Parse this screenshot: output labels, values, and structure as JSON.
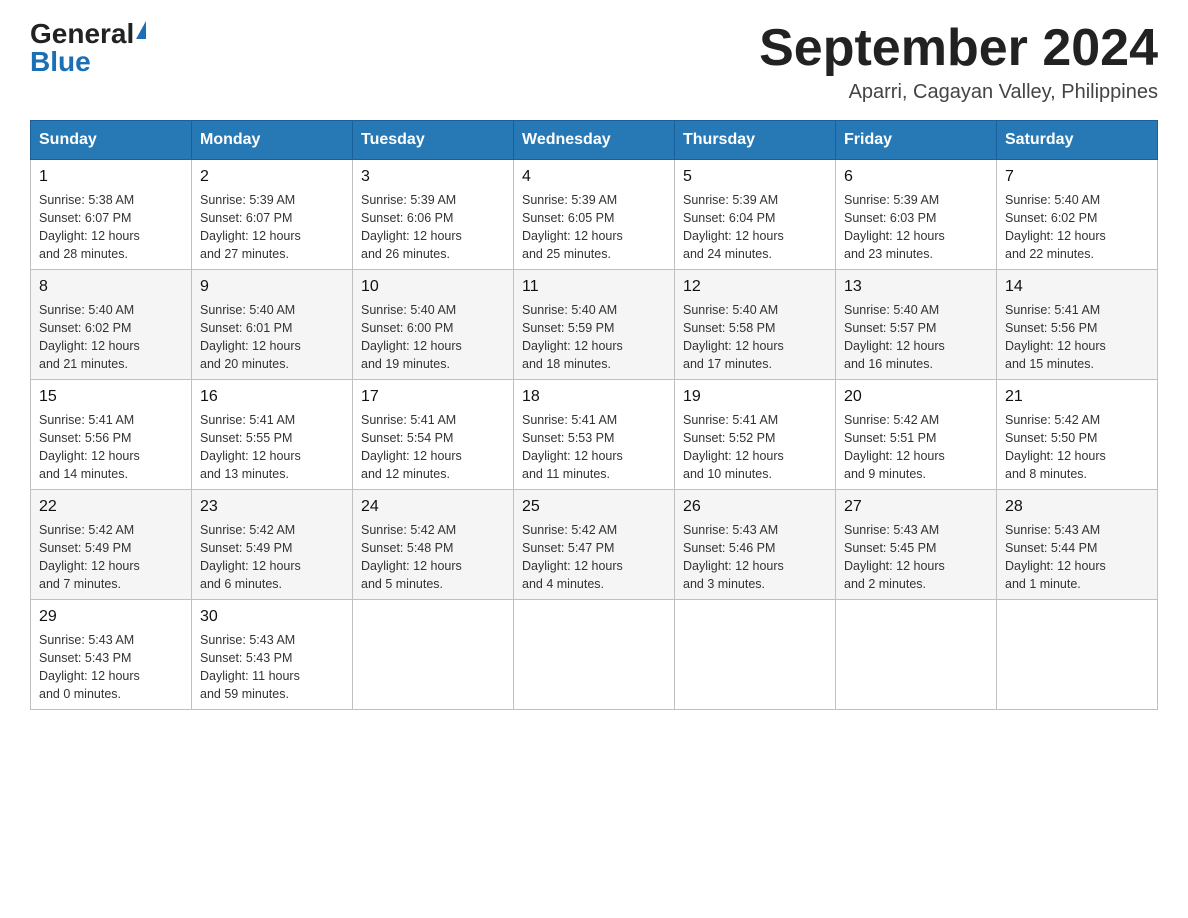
{
  "header": {
    "logo_general": "General",
    "logo_blue": "Blue",
    "title": "September 2024",
    "subtitle": "Aparri, Cagayan Valley, Philippines"
  },
  "days_of_week": [
    "Sunday",
    "Monday",
    "Tuesday",
    "Wednesday",
    "Thursday",
    "Friday",
    "Saturday"
  ],
  "weeks": [
    [
      {
        "day": "1",
        "sunrise": "5:38 AM",
        "sunset": "6:07 PM",
        "daylight": "12 hours and 28 minutes."
      },
      {
        "day": "2",
        "sunrise": "5:39 AM",
        "sunset": "6:07 PM",
        "daylight": "12 hours and 27 minutes."
      },
      {
        "day": "3",
        "sunrise": "5:39 AM",
        "sunset": "6:06 PM",
        "daylight": "12 hours and 26 minutes."
      },
      {
        "day": "4",
        "sunrise": "5:39 AM",
        "sunset": "6:05 PM",
        "daylight": "12 hours and 25 minutes."
      },
      {
        "day": "5",
        "sunrise": "5:39 AM",
        "sunset": "6:04 PM",
        "daylight": "12 hours and 24 minutes."
      },
      {
        "day": "6",
        "sunrise": "5:39 AM",
        "sunset": "6:03 PM",
        "daylight": "12 hours and 23 minutes."
      },
      {
        "day": "7",
        "sunrise": "5:40 AM",
        "sunset": "6:02 PM",
        "daylight": "12 hours and 22 minutes."
      }
    ],
    [
      {
        "day": "8",
        "sunrise": "5:40 AM",
        "sunset": "6:02 PM",
        "daylight": "12 hours and 21 minutes."
      },
      {
        "day": "9",
        "sunrise": "5:40 AM",
        "sunset": "6:01 PM",
        "daylight": "12 hours and 20 minutes."
      },
      {
        "day": "10",
        "sunrise": "5:40 AM",
        "sunset": "6:00 PM",
        "daylight": "12 hours and 19 minutes."
      },
      {
        "day": "11",
        "sunrise": "5:40 AM",
        "sunset": "5:59 PM",
        "daylight": "12 hours and 18 minutes."
      },
      {
        "day": "12",
        "sunrise": "5:40 AM",
        "sunset": "5:58 PM",
        "daylight": "12 hours and 17 minutes."
      },
      {
        "day": "13",
        "sunrise": "5:40 AM",
        "sunset": "5:57 PM",
        "daylight": "12 hours and 16 minutes."
      },
      {
        "day": "14",
        "sunrise": "5:41 AM",
        "sunset": "5:56 PM",
        "daylight": "12 hours and 15 minutes."
      }
    ],
    [
      {
        "day": "15",
        "sunrise": "5:41 AM",
        "sunset": "5:56 PM",
        "daylight": "12 hours and 14 minutes."
      },
      {
        "day": "16",
        "sunrise": "5:41 AM",
        "sunset": "5:55 PM",
        "daylight": "12 hours and 13 minutes."
      },
      {
        "day": "17",
        "sunrise": "5:41 AM",
        "sunset": "5:54 PM",
        "daylight": "12 hours and 12 minutes."
      },
      {
        "day": "18",
        "sunrise": "5:41 AM",
        "sunset": "5:53 PM",
        "daylight": "12 hours and 11 minutes."
      },
      {
        "day": "19",
        "sunrise": "5:41 AM",
        "sunset": "5:52 PM",
        "daylight": "12 hours and 10 minutes."
      },
      {
        "day": "20",
        "sunrise": "5:42 AM",
        "sunset": "5:51 PM",
        "daylight": "12 hours and 9 minutes."
      },
      {
        "day": "21",
        "sunrise": "5:42 AM",
        "sunset": "5:50 PM",
        "daylight": "12 hours and 8 minutes."
      }
    ],
    [
      {
        "day": "22",
        "sunrise": "5:42 AM",
        "sunset": "5:49 PM",
        "daylight": "12 hours and 7 minutes."
      },
      {
        "day": "23",
        "sunrise": "5:42 AM",
        "sunset": "5:49 PM",
        "daylight": "12 hours and 6 minutes."
      },
      {
        "day": "24",
        "sunrise": "5:42 AM",
        "sunset": "5:48 PM",
        "daylight": "12 hours and 5 minutes."
      },
      {
        "day": "25",
        "sunrise": "5:42 AM",
        "sunset": "5:47 PM",
        "daylight": "12 hours and 4 minutes."
      },
      {
        "day": "26",
        "sunrise": "5:43 AM",
        "sunset": "5:46 PM",
        "daylight": "12 hours and 3 minutes."
      },
      {
        "day": "27",
        "sunrise": "5:43 AM",
        "sunset": "5:45 PM",
        "daylight": "12 hours and 2 minutes."
      },
      {
        "day": "28",
        "sunrise": "5:43 AM",
        "sunset": "5:44 PM",
        "daylight": "12 hours and 1 minute."
      }
    ],
    [
      {
        "day": "29",
        "sunrise": "5:43 AM",
        "sunset": "5:43 PM",
        "daylight": "12 hours and 0 minutes."
      },
      {
        "day": "30",
        "sunrise": "5:43 AM",
        "sunset": "5:43 PM",
        "daylight": "11 hours and 59 minutes."
      },
      null,
      null,
      null,
      null,
      null
    ]
  ],
  "labels": {
    "sunrise": "Sunrise:",
    "sunset": "Sunset:",
    "daylight": "Daylight:"
  }
}
